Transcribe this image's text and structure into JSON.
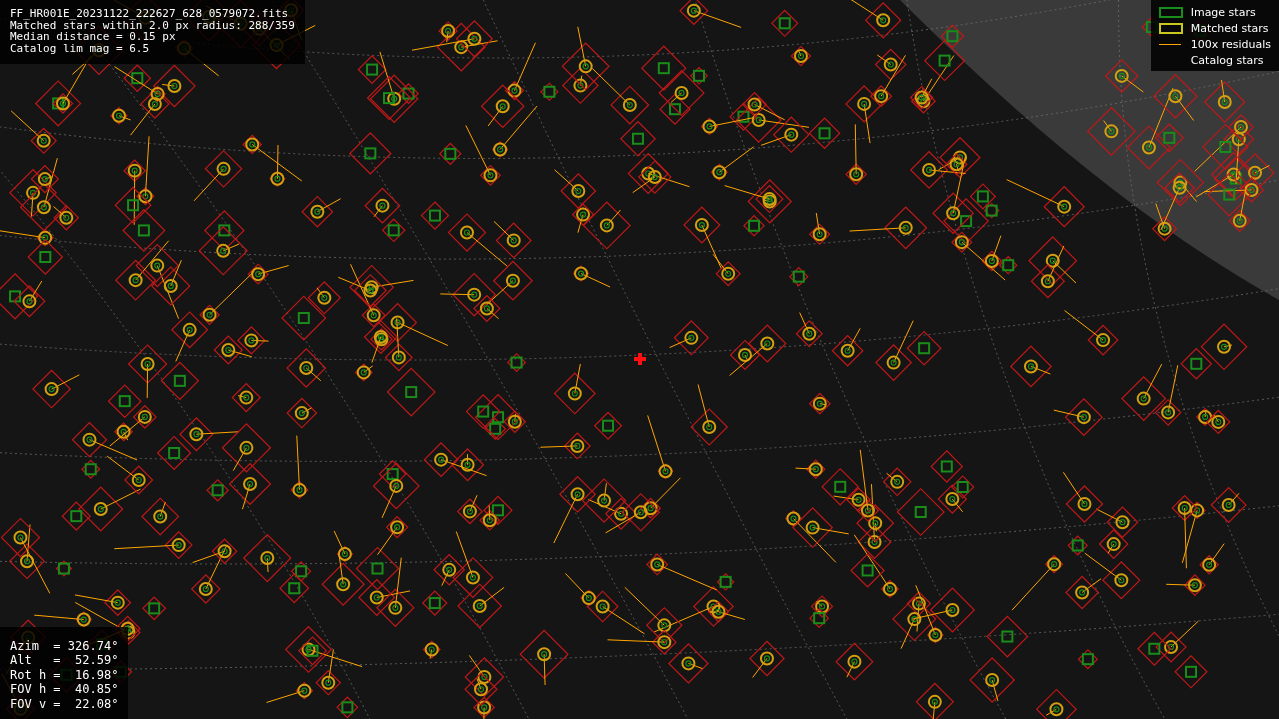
{
  "info_lines": [
    "FF_HR001E_20231122_222627_628_0579072.fits",
    "Matched stars within 2.0 px radius: 288/359",
    "Median distance = 0.15 px",
    "Catalog lim mag = 6.5"
  ],
  "legend": [
    {
      "label": "Image stars",
      "kind": "box",
      "color": "#1a8c1a"
    },
    {
      "label": "Matched stars",
      "kind": "box",
      "color": "#c8c81e"
    },
    {
      "label": "100x residuals",
      "kind": "line",
      "color": "#ffa500"
    },
    {
      "label": "Catalog stars",
      "kind": "blank"
    }
  ],
  "pointing": [
    "Azim  = 326.74°",
    "Alt   =  52.59°",
    "Rot h =  16.98°",
    "FOV h =  40.85°",
    "FOV v =  22.08°"
  ]
}
